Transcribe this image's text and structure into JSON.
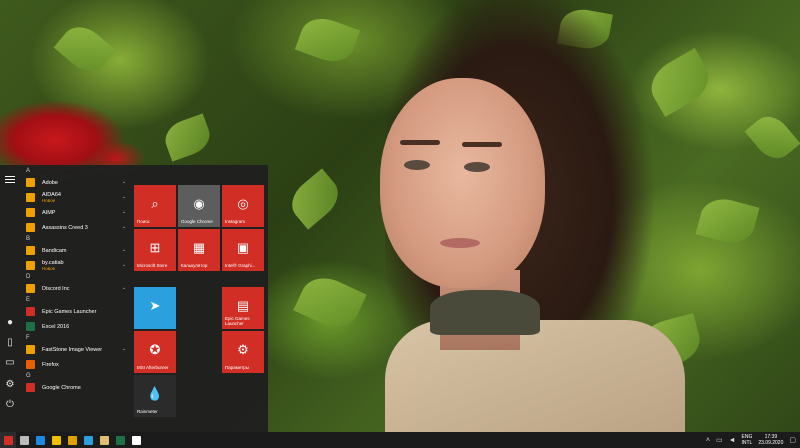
{
  "desktop": {
    "wallpaper_description_colors": {
      "leaves": "#7ea532",
      "rose": "#c8181c"
    }
  },
  "start_menu": {
    "app_list": [
      {
        "type": "letter",
        "label": "A"
      },
      {
        "type": "app",
        "name": "Adobe",
        "sub": "",
        "icon": "folder-icon",
        "color": "#f0a000",
        "expandable": true
      },
      {
        "type": "app",
        "name": "AIDA64",
        "sub": "Новое",
        "icon": "folder-icon",
        "color": "#f0a000",
        "expandable": true
      },
      {
        "type": "app",
        "name": "AIMP",
        "sub": "",
        "icon": "folder-icon",
        "color": "#f0a000",
        "expandable": true
      },
      {
        "type": "app",
        "name": "Assassins Creed 3",
        "sub": "",
        "icon": "folder-icon",
        "color": "#f0a000",
        "expandable": true
      },
      {
        "type": "letter",
        "label": "B"
      },
      {
        "type": "app",
        "name": "Bandicam",
        "sub": "",
        "icon": "folder-icon",
        "color": "#f0a000",
        "expandable": true
      },
      {
        "type": "app",
        "name": "by.catiab",
        "sub": "Новое",
        "icon": "folder-icon",
        "color": "#f0a000",
        "expandable": true
      },
      {
        "type": "letter",
        "label": "D"
      },
      {
        "type": "app",
        "name": "Discord Inc",
        "sub": "",
        "icon": "folder-icon",
        "color": "#f0a000",
        "expandable": true
      },
      {
        "type": "letter",
        "label": "E"
      },
      {
        "type": "app",
        "name": "Epic Games Launcher",
        "sub": "",
        "icon": "epic-games-icon",
        "color": "#d12f26",
        "expandable": false
      },
      {
        "type": "app",
        "name": "Excel 2016",
        "sub": "",
        "icon": "excel-icon",
        "color": "#1e7145",
        "expandable": false
      },
      {
        "type": "letter",
        "label": "F"
      },
      {
        "type": "app",
        "name": "FastStone Image Viewer",
        "sub": "",
        "icon": "folder-icon",
        "color": "#f0a000",
        "expandable": true
      },
      {
        "type": "app",
        "name": "Firefox",
        "sub": "",
        "icon": "firefox-icon",
        "color": "#e66000",
        "expandable": false
      },
      {
        "type": "letter",
        "label": "G"
      },
      {
        "type": "app",
        "name": "Google Chrome",
        "sub": "",
        "icon": "chrome-icon",
        "color": "#d12f26",
        "expandable": false
      }
    ],
    "tiles": [
      {
        "label": "Поиск",
        "icon": "search-icon",
        "glyph": "⌕",
        "color": "#d12f26"
      },
      {
        "label": "Google Chrome",
        "icon": "chrome-icon",
        "glyph": "◉",
        "color": "#5d5d5d"
      },
      {
        "label": "Instagram",
        "icon": "instagram-icon",
        "glyph": "◎",
        "color": "#d12f26"
      },
      {
        "label": "Microsoft Store",
        "icon": "store-icon",
        "glyph": "⊞",
        "color": "#d12f26"
      },
      {
        "label": "Калькулятор",
        "icon": "calculator-icon",
        "glyph": "▦",
        "color": "#d12f26"
      },
      {
        "label": "Intel® Graphi...",
        "icon": "intel-graphics-icon",
        "glyph": "▣",
        "color": "#d12f26"
      },
      {
        "label": "",
        "icon": "telegram-icon",
        "glyph": "➤",
        "color": "#2aa1de"
      },
      {
        "label": "Epic Games Launcher",
        "icon": "epic-games-icon",
        "glyph": "▤",
        "color": "#d12f26"
      },
      {
        "label": "MSI Afterburner",
        "icon": "msi-afterburner-icon",
        "glyph": "✪",
        "color": "#d12f26"
      },
      {
        "label": "Параметры",
        "icon": "gear-icon",
        "glyph": "⚙",
        "color": "#d12f26"
      },
      {
        "label": "Rainmeter",
        "icon": "rainmeter-icon",
        "glyph": "💧",
        "color": "#2b2b2b"
      }
    ],
    "rail_icons": [
      "hamburger-icon",
      "user-icon",
      "document-icon",
      "pictures-icon",
      "settings-icon",
      "power-icon"
    ]
  },
  "taskbar": {
    "pinned": [
      {
        "icon": "start-icon",
        "color": "#d12f26"
      },
      {
        "icon": "search-icon",
        "color": "#bbbbbb"
      },
      {
        "icon": "task-view-icon",
        "color": "#1e88e5"
      },
      {
        "icon": "file-explorer-icon",
        "color": "#f0c000"
      },
      {
        "icon": "chrome-icon",
        "color": "#e0a000"
      },
      {
        "icon": "telegram-icon",
        "color": "#2aa1de"
      },
      {
        "icon": "folder-icon",
        "color": "#e0c070"
      },
      {
        "icon": "excel-icon",
        "color": "#1e7145"
      },
      {
        "icon": "store-icon",
        "color": "#ffffff"
      }
    ],
    "tray": {
      "lang_top": "ENG",
      "lang_bottom": "INTL",
      "time": "17:39",
      "date": "23.09.2020"
    }
  }
}
